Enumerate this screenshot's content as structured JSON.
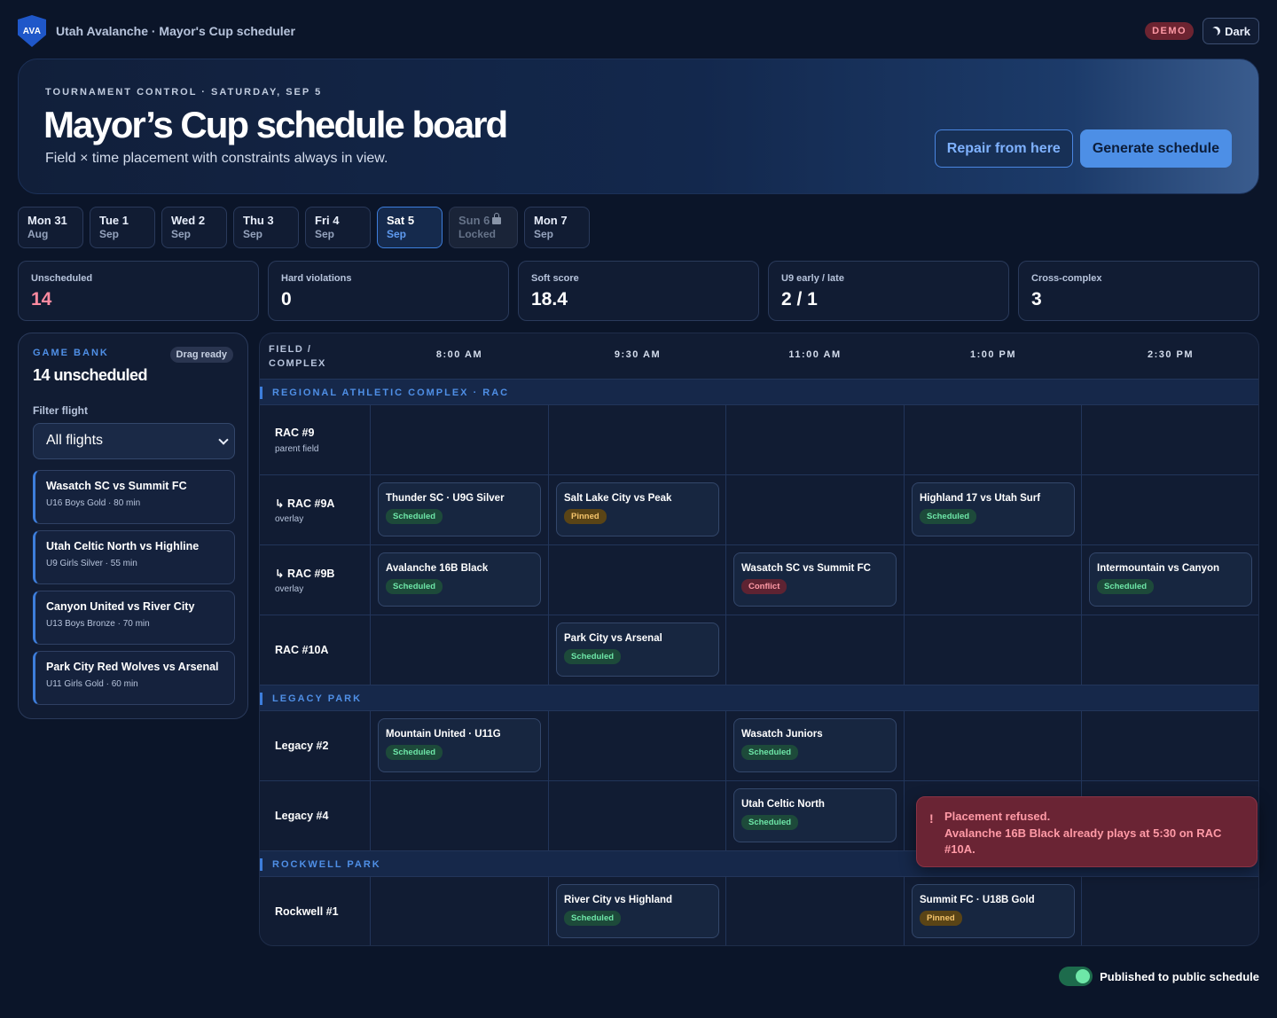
{
  "app": {
    "logo": "AVA",
    "title": "Utah Avalanche · Mayor's Cup scheduler",
    "demo": "DEMO",
    "theme": "Dark"
  },
  "hero": {
    "eyebrow": "TOURNAMENT CONTROL · SATURDAY, SEP 5",
    "title": "Mayor’s Cup schedule board",
    "subtitle": "Field × time placement with constraints always in view.",
    "repair_label": "Repair from here",
    "generate_label": "Generate schedule"
  },
  "days": [
    {
      "day": "Mon 31",
      "month": "Aug"
    },
    {
      "day": "Tue 1",
      "month": "Sep"
    },
    {
      "day": "Wed 2",
      "month": "Sep"
    },
    {
      "day": "Thu 3",
      "month": "Sep"
    },
    {
      "day": "Fri 4",
      "month": "Sep"
    },
    {
      "day": "Sat 5",
      "month": "Sep"
    },
    {
      "day": "Sun 6",
      "month": "Locked"
    },
    {
      "day": "Mon 7",
      "month": "Sep"
    }
  ],
  "stats": [
    {
      "label": "Unscheduled",
      "value": "14"
    },
    {
      "label": "Hard violations",
      "value": "0"
    },
    {
      "label": "Soft score",
      "value": "18.4"
    },
    {
      "label": "U9 early / late",
      "value": "2 / 1"
    },
    {
      "label": "Cross-complex",
      "value": "3"
    }
  ],
  "bank": {
    "eyebrow": "GAME BANK",
    "badge": "Drag ready",
    "count": "14 unscheduled",
    "filter_label": "Filter flight",
    "filter_value": "All flights",
    "items": [
      {
        "title": "Wasatch SC vs Summit FC",
        "sub": "U16 Boys Gold · 80 min"
      },
      {
        "title": "Utah Celtic North vs Highline",
        "sub": "U9 Girls Silver · 55 min"
      },
      {
        "title": "Canyon United vs River City",
        "sub": "U13 Boys Bronze · 70 min"
      },
      {
        "title": "Park City Red Wolves vs Arsenal",
        "sub": "U11 Girls Gold · 60 min"
      }
    ]
  },
  "board": {
    "field_header": "FIELD / COMPLEX",
    "times": [
      "8:00 AM",
      "9:30 AM",
      "11:00 AM",
      "1:00 PM",
      "2:30 PM"
    ],
    "sections": [
      "REGIONAL ATHLETIC COMPLEX · RAC",
      "LEGACY PARK",
      "ROCKWELL PARK"
    ],
    "rows": [
      {
        "label": "RAC #9",
        "sub": "parent field"
      },
      {
        "label": "↳ RAC #9A",
        "sub": "overlay"
      },
      {
        "label": "↳ RAC #9B",
        "sub": "overlay"
      },
      {
        "label": "RAC #10A",
        "sub": ""
      },
      {
        "label": "Legacy #2",
        "sub": ""
      },
      {
        "label": "Legacy #4",
        "sub": ""
      },
      {
        "label": "Rockwell #1",
        "sub": ""
      }
    ],
    "games": [
      {
        "title": "Thunder SC · U9G Silver",
        "status": "Scheduled"
      },
      {
        "title": "Salt Lake City vs Peak",
        "status": "Pinned"
      },
      {
        "title": "Highland 17 vs Utah Surf",
        "status": "Scheduled"
      },
      {
        "title": "Avalanche 16B Black",
        "status": "Scheduled"
      },
      {
        "title": "Wasatch SC vs Summit FC",
        "status": "Conflict"
      },
      {
        "title": "Intermountain vs Canyon",
        "status": "Scheduled"
      },
      {
        "title": "Park City vs Arsenal",
        "status": "Scheduled"
      },
      {
        "title": "Mountain United · U11G",
        "status": "Scheduled"
      },
      {
        "title": "Wasatch Juniors",
        "status": "Scheduled"
      },
      {
        "title": "Utah Celtic North",
        "status": "Scheduled"
      },
      {
        "title": "River City vs Highland",
        "status": "Scheduled"
      },
      {
        "title": "Summit FC · U18B Gold",
        "status": "Pinned"
      }
    ]
  },
  "toast": {
    "icon": "!",
    "title": "Placement refused.",
    "message": "Avalanche 16B Black already plays at 5:30 on RAC #10A."
  },
  "publish": {
    "label": "Published to public schedule",
    "on": true
  },
  "colors": {
    "accent": "#4d8fe6",
    "scheduled": "#6ee7a8",
    "pinned": "#f5c46b",
    "conflict": "#ff9aa6"
  }
}
